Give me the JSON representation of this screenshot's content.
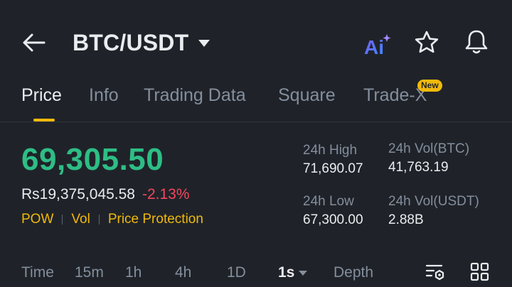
{
  "header": {
    "pair": "BTC/USDT",
    "ai_label": "Ai"
  },
  "tabs": [
    {
      "label": "Price",
      "active": true
    },
    {
      "label": "Info"
    },
    {
      "label": "Trading Data"
    },
    {
      "label": "Square"
    },
    {
      "label": "Trade-X",
      "badge": "New"
    }
  ],
  "price": {
    "last": "69,305.50",
    "fiat": "Rs19,375,045.58",
    "change": "-2.13%",
    "tags": [
      "POW",
      "Vol",
      "Price Protection"
    ]
  },
  "stats": {
    "high": {
      "label": "24h High",
      "value": "71,690.07"
    },
    "low": {
      "label": "24h Low",
      "value": "67,300.00"
    },
    "vol_base": {
      "label": "24h Vol(BTC)",
      "value": "41,763.19"
    },
    "vol_quote": {
      "label": "24h Vol(USDT)",
      "value": "2.88B"
    }
  },
  "toolbar": {
    "items": [
      "Time",
      "15m",
      "1h",
      "4h",
      "1D",
      "1s",
      "Depth"
    ],
    "active": "1s"
  },
  "colors": {
    "background": "#1f2329",
    "up": "#2ebd85",
    "down": "#f6465d",
    "accent": "#f0b90b",
    "muted": "#848e9c"
  }
}
